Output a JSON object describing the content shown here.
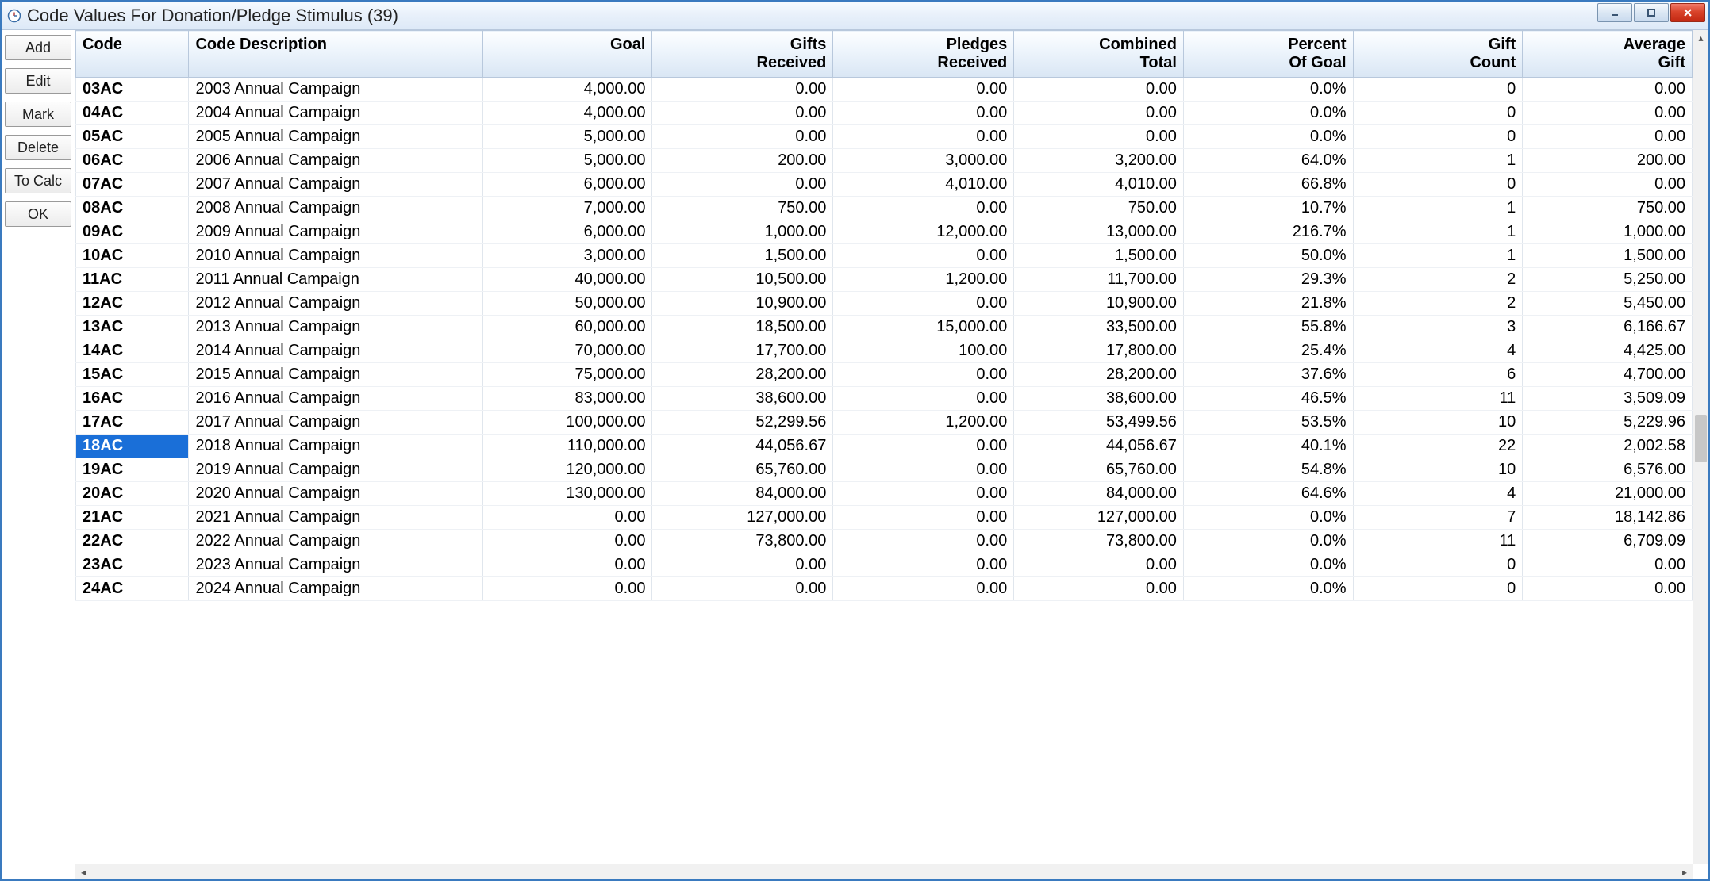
{
  "window": {
    "title": "Code Values For Donation/Pledge Stimulus (39)"
  },
  "sidebar": {
    "buttons": [
      {
        "id": "add",
        "label": "Add"
      },
      {
        "id": "edit",
        "label": "Edit"
      },
      {
        "id": "mark",
        "label": "Mark"
      },
      {
        "id": "delete",
        "label": "Delete"
      },
      {
        "id": "tocalc",
        "label": "To Calc"
      },
      {
        "id": "ok",
        "label": "OK"
      }
    ]
  },
  "grid": {
    "columns": {
      "code": "Code",
      "desc": "Code Description",
      "goal": "Goal",
      "gifts_l1": "Gifts",
      "gifts_l2": "Received",
      "pledges_l1": "Pledges",
      "pledges_l2": "Received",
      "comb_l1": "Combined",
      "comb_l2": "Total",
      "pct_l1": "Percent",
      "pct_l2": "Of Goal",
      "cnt_l1": "Gift",
      "cnt_l2": "Count",
      "avg_l1": "Average",
      "avg_l2": "Gift"
    },
    "selected_code": "18AC",
    "rows": [
      {
        "code": "03AC",
        "desc": "2003 Annual Campaign",
        "goal": "4,000.00",
        "gifts": "0.00",
        "pledges": "0.00",
        "comb": "0.00",
        "pct": "0.0%",
        "cnt": "0",
        "avg": "0.00"
      },
      {
        "code": "04AC",
        "desc": "2004 Annual Campaign",
        "goal": "4,000.00",
        "gifts": "0.00",
        "pledges": "0.00",
        "comb": "0.00",
        "pct": "0.0%",
        "cnt": "0",
        "avg": "0.00"
      },
      {
        "code": "05AC",
        "desc": "2005 Annual Campaign",
        "goal": "5,000.00",
        "gifts": "0.00",
        "pledges": "0.00",
        "comb": "0.00",
        "pct": "0.0%",
        "cnt": "0",
        "avg": "0.00"
      },
      {
        "code": "06AC",
        "desc": "2006 Annual Campaign",
        "goal": "5,000.00",
        "gifts": "200.00",
        "pledges": "3,000.00",
        "comb": "3,200.00",
        "pct": "64.0%",
        "cnt": "1",
        "avg": "200.00"
      },
      {
        "code": "07AC",
        "desc": "2007 Annual Campaign",
        "goal": "6,000.00",
        "gifts": "0.00",
        "pledges": "4,010.00",
        "comb": "4,010.00",
        "pct": "66.8%",
        "cnt": "0",
        "avg": "0.00"
      },
      {
        "code": "08AC",
        "desc": "2008 Annual Campaign",
        "goal": "7,000.00",
        "gifts": "750.00",
        "pledges": "0.00",
        "comb": "750.00",
        "pct": "10.7%",
        "cnt": "1",
        "avg": "750.00"
      },
      {
        "code": "09AC",
        "desc": "2009 Annual Campaign",
        "goal": "6,000.00",
        "gifts": "1,000.00",
        "pledges": "12,000.00",
        "comb": "13,000.00",
        "pct": "216.7%",
        "cnt": "1",
        "avg": "1,000.00"
      },
      {
        "code": "10AC",
        "desc": "2010 Annual Campaign",
        "goal": "3,000.00",
        "gifts": "1,500.00",
        "pledges": "0.00",
        "comb": "1,500.00",
        "pct": "50.0%",
        "cnt": "1",
        "avg": "1,500.00"
      },
      {
        "code": "11AC",
        "desc": "2011 Annual Campaign",
        "goal": "40,000.00",
        "gifts": "10,500.00",
        "pledges": "1,200.00",
        "comb": "11,700.00",
        "pct": "29.3%",
        "cnt": "2",
        "avg": "5,250.00"
      },
      {
        "code": "12AC",
        "desc": "2012 Annual Campaign",
        "goal": "50,000.00",
        "gifts": "10,900.00",
        "pledges": "0.00",
        "comb": "10,900.00",
        "pct": "21.8%",
        "cnt": "2",
        "avg": "5,450.00"
      },
      {
        "code": "13AC",
        "desc": "2013 Annual Campaign",
        "goal": "60,000.00",
        "gifts": "18,500.00",
        "pledges": "15,000.00",
        "comb": "33,500.00",
        "pct": "55.8%",
        "cnt": "3",
        "avg": "6,166.67"
      },
      {
        "code": "14AC",
        "desc": "2014 Annual Campaign",
        "goal": "70,000.00",
        "gifts": "17,700.00",
        "pledges": "100.00",
        "comb": "17,800.00",
        "pct": "25.4%",
        "cnt": "4",
        "avg": "4,425.00"
      },
      {
        "code": "15AC",
        "desc": "2015 Annual Campaign",
        "goal": "75,000.00",
        "gifts": "28,200.00",
        "pledges": "0.00",
        "comb": "28,200.00",
        "pct": "37.6%",
        "cnt": "6",
        "avg": "4,700.00"
      },
      {
        "code": "16AC",
        "desc": "2016 Annual Campaign",
        "goal": "83,000.00",
        "gifts": "38,600.00",
        "pledges": "0.00",
        "comb": "38,600.00",
        "pct": "46.5%",
        "cnt": "11",
        "avg": "3,509.09"
      },
      {
        "code": "17AC",
        "desc": "2017 Annual Campaign",
        "goal": "100,000.00",
        "gifts": "52,299.56",
        "pledges": "1,200.00",
        "comb": "53,499.56",
        "pct": "53.5%",
        "cnt": "10",
        "avg": "5,229.96"
      },
      {
        "code": "18AC",
        "desc": "2018 Annual Campaign",
        "goal": "110,000.00",
        "gifts": "44,056.67",
        "pledges": "0.00",
        "comb": "44,056.67",
        "pct": "40.1%",
        "cnt": "22",
        "avg": "2,002.58"
      },
      {
        "code": "19AC",
        "desc": "2019 Annual Campaign",
        "goal": "120,000.00",
        "gifts": "65,760.00",
        "pledges": "0.00",
        "comb": "65,760.00",
        "pct": "54.8%",
        "cnt": "10",
        "avg": "6,576.00"
      },
      {
        "code": "20AC",
        "desc": "2020 Annual Campaign",
        "goal": "130,000.00",
        "gifts": "84,000.00",
        "pledges": "0.00",
        "comb": "84,000.00",
        "pct": "64.6%",
        "cnt": "4",
        "avg": "21,000.00"
      },
      {
        "code": "21AC",
        "desc": "2021 Annual Campaign",
        "goal": "0.00",
        "gifts": "127,000.00",
        "pledges": "0.00",
        "comb": "127,000.00",
        "pct": "0.0%",
        "cnt": "7",
        "avg": "18,142.86"
      },
      {
        "code": "22AC",
        "desc": "2022 Annual Campaign",
        "goal": "0.00",
        "gifts": "73,800.00",
        "pledges": "0.00",
        "comb": "73,800.00",
        "pct": "0.0%",
        "cnt": "11",
        "avg": "6,709.09"
      },
      {
        "code": "23AC",
        "desc": "2023 Annual Campaign",
        "goal": "0.00",
        "gifts": "0.00",
        "pledges": "0.00",
        "comb": "0.00",
        "pct": "0.0%",
        "cnt": "0",
        "avg": "0.00"
      },
      {
        "code": "24AC",
        "desc": "2024 Annual Campaign",
        "goal": "0.00",
        "gifts": "0.00",
        "pledges": "0.00",
        "comb": "0.00",
        "pct": "0.0%",
        "cnt": "0",
        "avg": "0.00"
      }
    ]
  }
}
